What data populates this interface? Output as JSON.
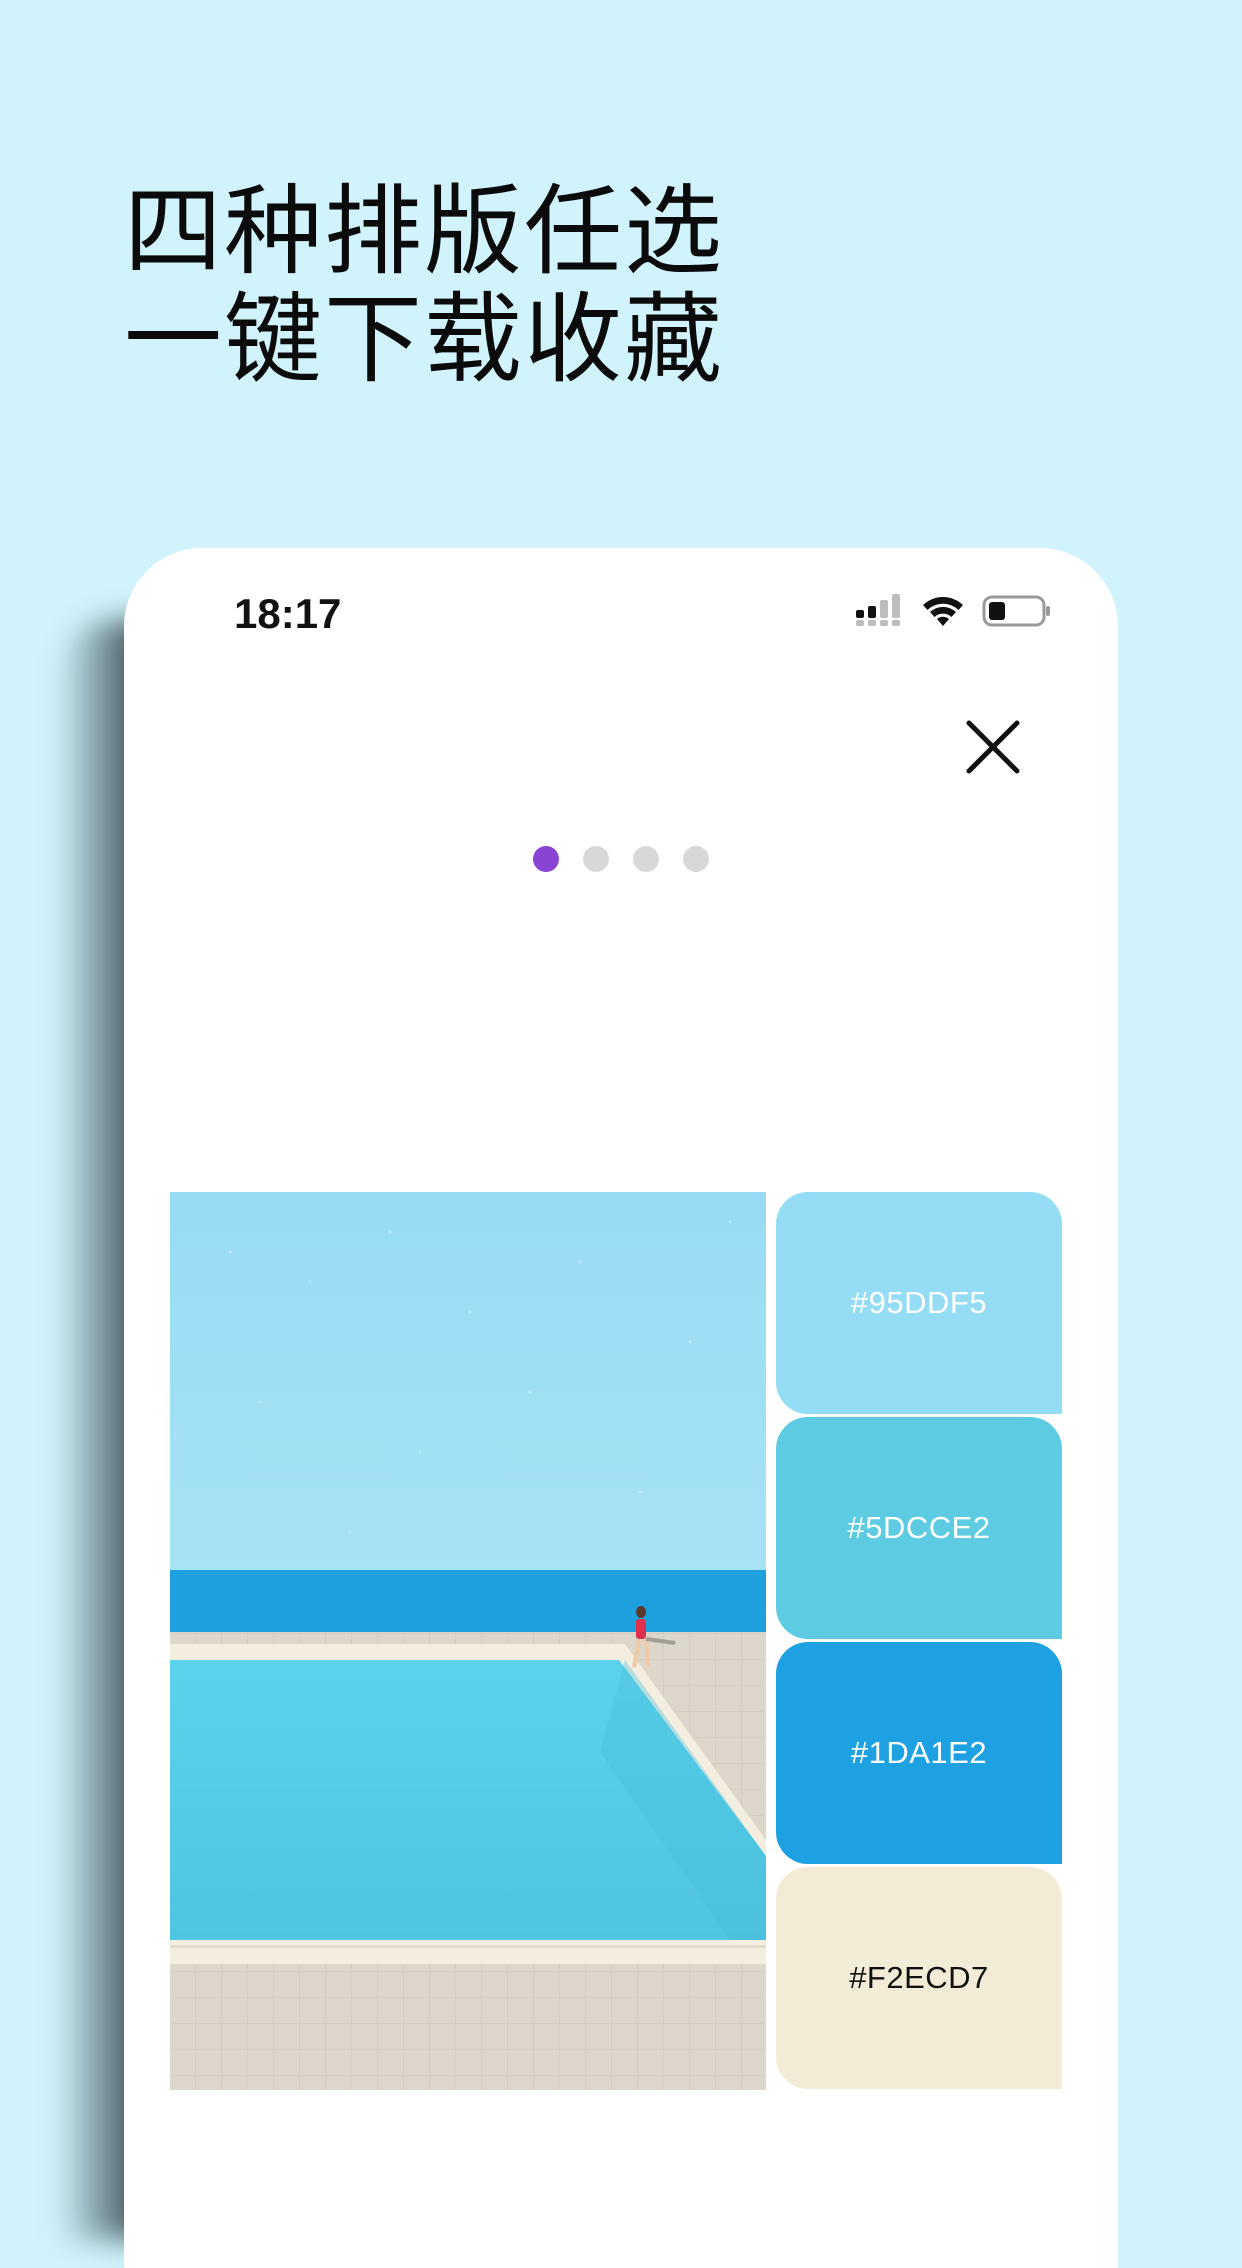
{
  "headline": {
    "line1": "四种排版任选",
    "line2": "一键下载收藏"
  },
  "status_bar": {
    "time": "18:17",
    "icons": [
      "signal-icon",
      "wifi-icon",
      "battery-icon"
    ]
  },
  "close_icon": "close-icon",
  "pager": {
    "count": 4,
    "active_index": 0,
    "active_color": "#8A44D4",
    "inactive_color": "#D8D8D8"
  },
  "artwork": {
    "scene": "pool-illustration",
    "colors": {
      "sky": "#95DDF5",
      "sea": "#1DA1E2",
      "pool": "#5DCCE2",
      "deck": "#F2ECD7"
    }
  },
  "palette": [
    {
      "label": "#95DDF5",
      "color": "#95DDF5",
      "text_color": "#FFFFFF"
    },
    {
      "label": "#5DCCE2",
      "color": "#5DCCE2",
      "text_color": "#FFFFFF"
    },
    {
      "label": "#1DA1E2",
      "color": "#1DA1E2",
      "text_color": "#FFFFFF"
    },
    {
      "label": "#F2ECD7",
      "color": "#F2ECD7",
      "text_color": "#111111"
    }
  ],
  "background_color": "#D0F3FC"
}
